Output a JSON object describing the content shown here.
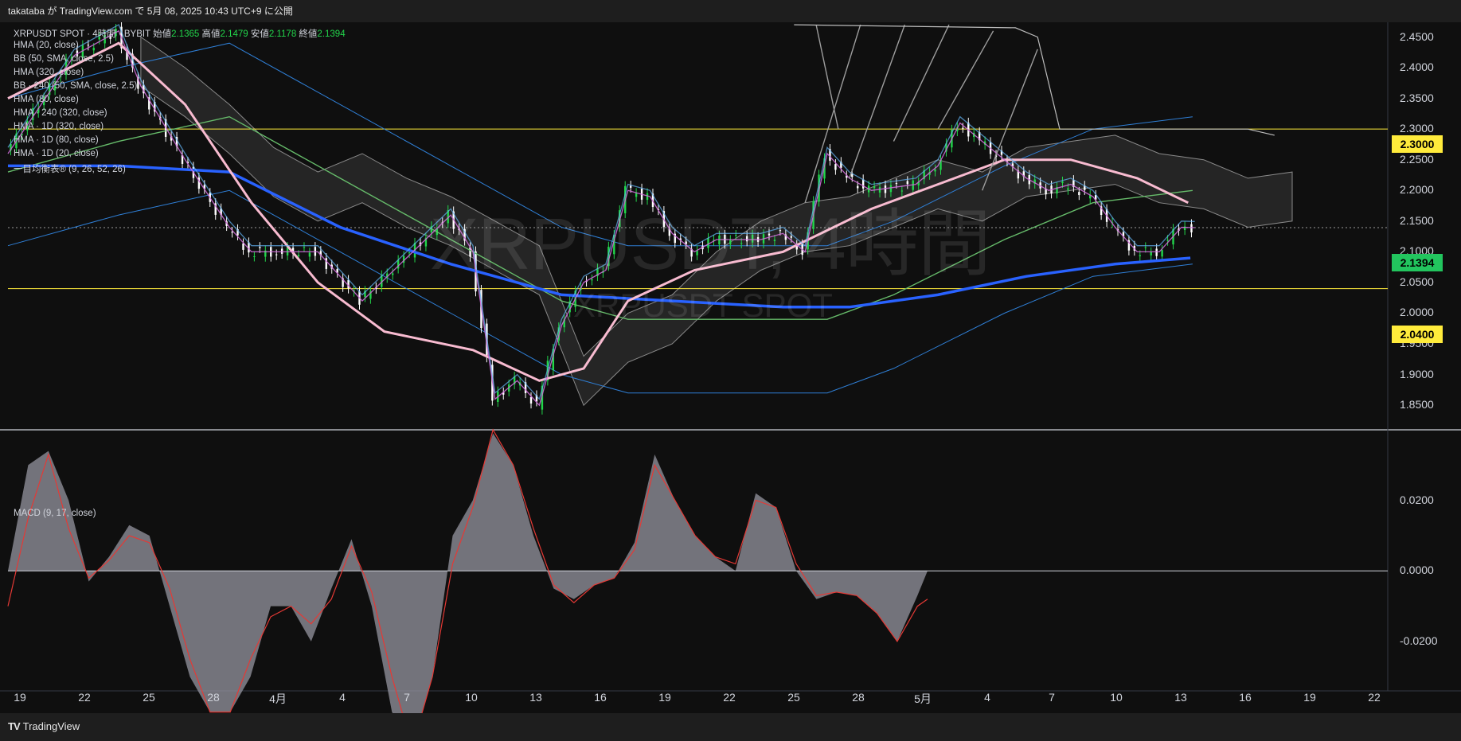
{
  "header": {
    "publish_text": "takataba が TradingView.com で 5月 08, 2025 10:43 UTC+9 に公開"
  },
  "main_legend": {
    "symbol": "XRPUSDT SPOT · 4時間 · BYBIT",
    "open_label": "始値",
    "open_value": "2.1365",
    "high_label": "高値",
    "high_value": "2.1479",
    "low_label": "安値",
    "low_value": "2.1178",
    "close_label": "終値",
    "close_value": "2.1394"
  },
  "indicators": [
    "HMA (20, close)",
    "BB (50, SMA, close, 2.5)",
    "HMA (320, close)",
    "BB · 240 (50, SMA, close, 2.5)",
    "HMA (80, close)",
    "HMA · 240 (320, close)",
    "HMA · 1D (320, close)",
    "HMA · 1D (80, close)",
    "HMA · 1D (20, close)",
    "一目均衡表® (9, 26, 52, 26)"
  ],
  "watermark": {
    "title": "XRPUSDT, 4時間",
    "subtitle": "XRPUSDT SPOT"
  },
  "macd_legend": "MACD (9, 17, close)",
  "price_tags": [
    {
      "value": "2.3000",
      "bg": "#ffeb3b",
      "fg": "#000000"
    },
    {
      "value": "2.1394",
      "bg": "#22c55e",
      "fg": "#000000"
    },
    {
      "value": "2.0400",
      "bg": "#ffeb3b",
      "fg": "#000000"
    }
  ],
  "branding": {
    "logo_mark": "TV",
    "name": "TradingView"
  },
  "chart_data": {
    "type": "line",
    "main_pane": {
      "y_ticks": [
        "2.4500",
        "2.4000",
        "2.3500",
        "2.3000",
        "2.2500",
        "2.2000",
        "2.1500",
        "2.1000",
        "2.0500",
        "2.0000",
        "1.9500",
        "1.9000",
        "1.8500"
      ],
      "ylim": [
        1.81,
        2.474
      ],
      "horizontal_levels": [
        2.3,
        2.04
      ],
      "last_price": 2.1394,
      "price_path": [
        [
          0,
          2.26
        ],
        [
          3,
          2.42
        ],
        [
          5,
          2.46
        ],
        [
          6,
          2.37
        ],
        [
          8,
          2.25
        ],
        [
          10,
          2.14
        ],
        [
          11,
          2.1
        ],
        [
          12,
          2.1
        ],
        [
          14,
          2.1
        ],
        [
          16,
          2.02
        ],
        [
          18,
          2.09
        ],
        [
          20,
          2.16
        ],
        [
          21,
          2.1
        ],
        [
          22,
          1.86
        ],
        [
          23,
          1.89
        ],
        [
          24,
          1.85
        ],
        [
          25,
          1.98
        ],
        [
          26,
          2.05
        ],
        [
          27,
          2.07
        ],
        [
          28,
          2.2
        ],
        [
          29,
          2.19
        ],
        [
          30,
          2.13
        ],
        [
          31,
          2.1
        ],
        [
          32,
          2.12
        ],
        [
          34,
          2.12
        ],
        [
          35,
          2.13
        ],
        [
          36,
          2.1
        ],
        [
          37,
          2.26
        ],
        [
          38,
          2.22
        ],
        [
          39,
          2.2
        ],
        [
          41,
          2.21
        ],
        [
          42,
          2.24
        ],
        [
          43,
          2.31
        ],
        [
          44,
          2.28
        ],
        [
          45,
          2.25
        ],
        [
          46,
          2.22
        ],
        [
          47,
          2.2
        ],
        [
          48,
          2.21
        ],
        [
          49,
          2.19
        ],
        [
          50,
          2.14
        ],
        [
          51,
          2.1
        ],
        [
          52,
          2.1
        ],
        [
          53,
          2.14
        ],
        [
          53.6,
          2.1394
        ]
      ],
      "hma_pink_path": [
        [
          0,
          2.35
        ],
        [
          5,
          2.44
        ],
        [
          8,
          2.34
        ],
        [
          11,
          2.18
        ],
        [
          14,
          2.05
        ],
        [
          17,
          1.97
        ],
        [
          21,
          1.94
        ],
        [
          24,
          1.89
        ],
        [
          26,
          1.91
        ],
        [
          28,
          2.02
        ],
        [
          31,
          2.07
        ],
        [
          35,
          2.1
        ],
        [
          39,
          2.17
        ],
        [
          42,
          2.21
        ],
        [
          45,
          2.25
        ],
        [
          48,
          2.25
        ],
        [
          51,
          2.22
        ],
        [
          53.3,
          2.18
        ]
      ],
      "hma_blue_path": [
        [
          0,
          2.24
        ],
        [
          5,
          2.24
        ],
        [
          10,
          2.23
        ],
        [
          15,
          2.14
        ],
        [
          20,
          2.08
        ],
        [
          25,
          2.03
        ],
        [
          30,
          2.02
        ],
        [
          35,
          2.01
        ],
        [
          38,
          2.01
        ],
        [
          42,
          2.03
        ],
        [
          46,
          2.06
        ],
        [
          50,
          2.08
        ],
        [
          53.4,
          2.09
        ]
      ],
      "hma_green_path": [
        [
          0,
          2.23
        ],
        [
          5,
          2.28
        ],
        [
          10,
          2.32
        ],
        [
          15,
          2.22
        ],
        [
          20,
          2.12
        ],
        [
          25,
          2.02
        ],
        [
          28,
          1.99
        ],
        [
          33,
          1.99
        ],
        [
          37,
          1.99
        ],
        [
          40,
          2.03
        ],
        [
          45,
          2.12
        ],
        [
          49,
          2.18
        ],
        [
          53.5,
          2.2
        ]
      ],
      "cloud_path": [
        [
          6,
          2.4
        ],
        [
          8,
          2.35
        ],
        [
          10,
          2.29
        ],
        [
          12,
          2.22
        ],
        [
          14,
          2.18
        ],
        [
          16,
          2.21
        ],
        [
          18,
          2.17
        ],
        [
          20,
          2.14
        ],
        [
          22,
          2.1
        ],
        [
          24,
          2.06
        ],
        [
          26,
          1.88
        ],
        [
          28,
          1.95
        ],
        [
          30,
          1.98
        ],
        [
          32,
          2.05
        ],
        [
          34,
          2.1
        ],
        [
          36,
          2.13
        ],
        [
          38,
          2.14
        ],
        [
          40,
          2.17
        ],
        [
          42,
          2.2
        ],
        [
          44,
          2.18
        ],
        [
          46,
          2.22
        ],
        [
          48,
          2.23
        ],
        [
          50,
          2.24
        ],
        [
          52,
          2.21
        ],
        [
          54,
          2.2
        ],
        [
          56,
          2.17
        ],
        [
          58,
          2.18
        ]
      ]
    },
    "macd_pane": {
      "title": "MACD (9, 17, close)",
      "y_ticks": [
        "0.0200",
        "0.0000",
        "-0.0200"
      ],
      "ylim": [
        -0.034,
        0.04
      ],
      "histogram": [
        [
          0,
          0.0
        ],
        [
          1,
          0.03
        ],
        [
          2,
          0.034
        ],
        [
          3,
          0.02
        ],
        [
          4,
          -0.003
        ],
        [
          5,
          0.004
        ],
        [
          6,
          0.013
        ],
        [
          7,
          0.01
        ],
        [
          8,
          -0.01
        ],
        [
          9,
          -0.03
        ],
        [
          10,
          -0.04
        ],
        [
          11,
          -0.04
        ],
        [
          12,
          -0.03
        ],
        [
          13,
          -0.01
        ],
        [
          14,
          -0.01
        ],
        [
          15,
          -0.02
        ],
        [
          16,
          -0.005
        ],
        [
          17,
          0.009
        ],
        [
          18,
          -0.01
        ],
        [
          19,
          -0.04
        ],
        [
          20,
          -0.05
        ],
        [
          21,
          -0.03
        ],
        [
          22,
          0.01
        ],
        [
          23,
          0.02
        ],
        [
          24,
          0.039
        ],
        [
          25,
          0.03
        ],
        [
          26,
          0.01
        ],
        [
          27,
          -0.005
        ],
        [
          28,
          -0.008
        ],
        [
          29,
          -0.004
        ],
        [
          30,
          -0.002
        ],
        [
          31,
          0.008
        ],
        [
          32,
          0.033
        ],
        [
          33,
          0.02
        ],
        [
          34,
          0.01
        ],
        [
          35,
          0.004
        ],
        [
          36,
          0.0
        ],
        [
          37,
          0.022
        ],
        [
          38,
          0.018
        ],
        [
          39,
          0.0
        ],
        [
          40,
          -0.008
        ],
        [
          41,
          -0.006
        ],
        [
          42,
          -0.007
        ],
        [
          43,
          -0.012
        ],
        [
          44,
          -0.02
        ],
        [
          45,
          -0.007
        ],
        [
          45.5,
          0.0
        ]
      ],
      "signal": [
        [
          0,
          -0.01
        ],
        [
          1,
          0.015
        ],
        [
          2,
          0.033
        ],
        [
          3,
          0.012
        ],
        [
          4,
          -0.002
        ],
        [
          5,
          0.003
        ],
        [
          6,
          0.01
        ],
        [
          7,
          0.008
        ],
        [
          8,
          -0.005
        ],
        [
          9,
          -0.025
        ],
        [
          10,
          -0.04
        ],
        [
          11,
          -0.04
        ],
        [
          12,
          -0.025
        ],
        [
          13,
          -0.013
        ],
        [
          14,
          -0.01
        ],
        [
          15,
          -0.015
        ],
        [
          16,
          -0.008
        ],
        [
          17,
          0.007
        ],
        [
          18,
          -0.006
        ],
        [
          19,
          -0.03
        ],
        [
          20,
          -0.05
        ],
        [
          21,
          -0.03
        ],
        [
          22,
          0.002
        ],
        [
          23,
          0.018
        ],
        [
          24,
          0.04
        ],
        [
          25,
          0.03
        ],
        [
          26,
          0.012
        ],
        [
          27,
          -0.004
        ],
        [
          28,
          -0.009
        ],
        [
          29,
          -0.004
        ],
        [
          30,
          -0.002
        ],
        [
          31,
          0.006
        ],
        [
          32,
          0.03
        ],
        [
          33,
          0.02
        ],
        [
          34,
          0.01
        ],
        [
          35,
          0.004
        ],
        [
          36,
          0.002
        ],
        [
          37,
          0.02
        ],
        [
          38,
          0.018
        ],
        [
          39,
          0.002
        ],
        [
          40,
          -0.007
        ],
        [
          41,
          -0.006
        ],
        [
          42,
          -0.007
        ],
        [
          43,
          -0.012
        ],
        [
          44,
          -0.02
        ],
        [
          45,
          -0.01
        ],
        [
          45.5,
          -0.008
        ]
      ]
    },
    "x_ticks": [
      "19",
      "22",
      "25",
      "28",
      "4月",
      "4",
      "7",
      "10",
      "13",
      "16",
      "19",
      "22",
      "25",
      "28",
      "5月",
      "4",
      "7",
      "10",
      "13",
      "16",
      "19",
      "22"
    ]
  }
}
